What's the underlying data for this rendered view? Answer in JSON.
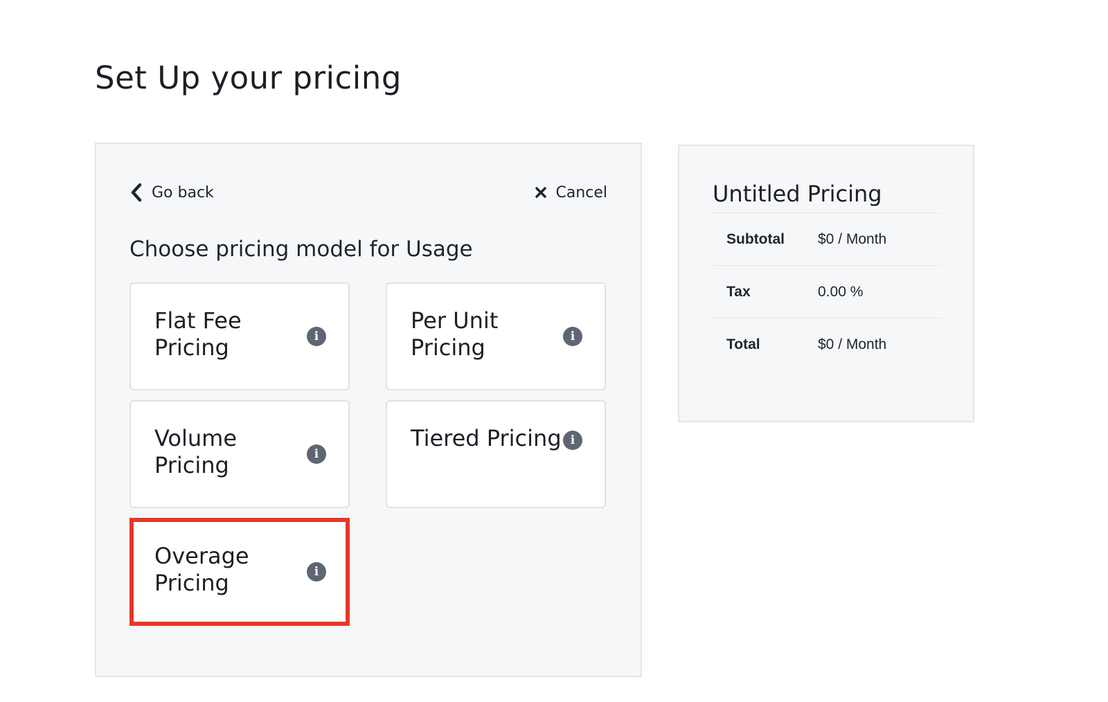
{
  "page": {
    "title": "Set Up your pricing"
  },
  "nav": {
    "back_label": "Go back",
    "cancel_label": "Cancel"
  },
  "model_picker": {
    "heading": "Choose pricing model for Usage",
    "options": [
      {
        "label": "Flat Fee Pricing",
        "info_icon": "info-icon"
      },
      {
        "label": "Per Unit Pricing",
        "info_icon": "info-icon"
      },
      {
        "label": "Volume Pricing",
        "info_icon": "info-icon"
      },
      {
        "label": "Tiered Pricing",
        "info_icon": "info-icon"
      },
      {
        "label": "Overage Pricing",
        "info_icon": "info-icon",
        "highlighted": true
      }
    ]
  },
  "summary": {
    "title": "Untitled Pricing",
    "rows": [
      {
        "label": "Subtotal",
        "value": "$0 / Month"
      },
      {
        "label": "Tax",
        "value": "0.00 %"
      },
      {
        "label": "Total",
        "value": "$0 / Month"
      }
    ]
  },
  "colors": {
    "highlight_border": "#e5372a",
    "panel_background": "#f6f7f8",
    "info_icon": "#5f6673"
  }
}
